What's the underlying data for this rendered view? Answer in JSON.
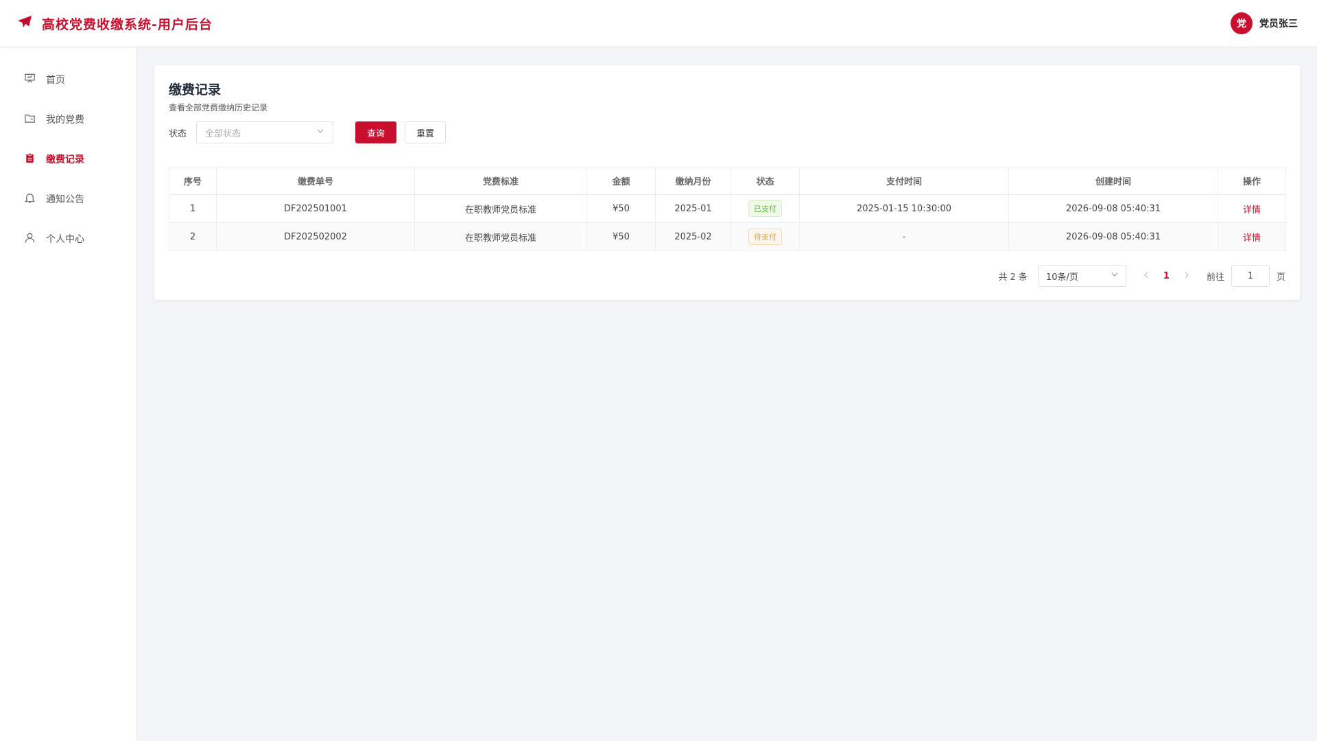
{
  "header": {
    "title": "高校党费收缴系统-用户后台",
    "avatar_text": "党",
    "user_name": "党员张三",
    "accent": "#c8102e"
  },
  "sidebar": {
    "items": [
      {
        "label": "首页",
        "icon": "presentation-icon",
        "active": false
      },
      {
        "label": "我的党费",
        "icon": "folder-icon",
        "active": false
      },
      {
        "label": "缴费记录",
        "icon": "clipboard-icon",
        "active": true
      },
      {
        "label": "通知公告",
        "icon": "bell-icon",
        "active": false
      },
      {
        "label": "个人中心",
        "icon": "user-icon",
        "active": false
      }
    ]
  },
  "main": {
    "title": "缴费记录",
    "subtitle": "查看全部党费缴纳历史记录",
    "filter": {
      "status_label": "状态",
      "status_placeholder": "全部状态",
      "query_button": "查询",
      "reset_button": "重置"
    },
    "table": {
      "columns": [
        "序号",
        "缴费单号",
        "党费标准",
        "金额",
        "缴纳月份",
        "状态",
        "支付时间",
        "创建时间",
        "操作"
      ],
      "rows": [
        {
          "index": "1",
          "order_no": "DF202501001",
          "standard": "在职教师党员标准",
          "amount": "¥50",
          "month": "2025-01",
          "status": "已支付",
          "status_type": "paid",
          "pay_time": "2025-01-15 10:30:00",
          "created": "2026-09-08 05:40:31",
          "action": "详情"
        },
        {
          "index": "2",
          "order_no": "DF202502002",
          "standard": "在职教师党员标准",
          "amount": "¥50",
          "month": "2025-02",
          "status": "待支付",
          "status_type": "pending",
          "pay_time": "-",
          "created": "2026-09-08 05:40:31",
          "action": "详情"
        }
      ]
    },
    "pagination": {
      "total_text": "共 2 条",
      "page_size": "10条/页",
      "current_page": "1",
      "goto_label": "前往",
      "goto_value": "1",
      "page_suffix": "页"
    }
  }
}
